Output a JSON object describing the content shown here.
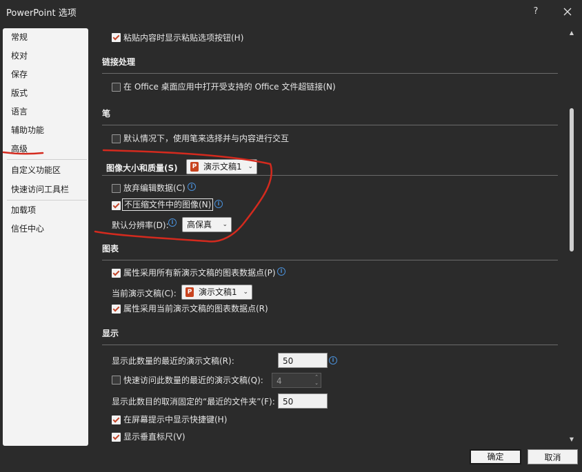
{
  "window": {
    "title": "PowerPoint 选项",
    "help_label": "?",
    "buttons": {
      "ok": "确定",
      "cancel": "取消"
    }
  },
  "sidebar": {
    "items": [
      {
        "label": "常规"
      },
      {
        "label": "校对"
      },
      {
        "label": "保存"
      },
      {
        "label": "版式"
      },
      {
        "label": "语言"
      },
      {
        "label": "辅助功能"
      },
      {
        "label": "高级",
        "selected": true
      },
      {
        "label": "自定义功能区"
      },
      {
        "label": "快速访问工具栏"
      },
      {
        "label": "加载项"
      },
      {
        "label": "信任中心"
      }
    ]
  },
  "content": {
    "paste_option": {
      "label": "粘贴内容时显示粘贴选项按钮(H)",
      "checked": true
    },
    "link_section": {
      "title": "链接处理",
      "open_links": {
        "label": "在 Office 桌面应用中打开受支持的 Office 文件超链接(N)",
        "checked": false
      }
    },
    "pen_section": {
      "title": "笔",
      "use_pen": {
        "label": "默认情况下，使用笔来选择并与内容进行交互",
        "checked": false
      }
    },
    "image_section": {
      "title": "图像大小和质量(S)",
      "document": "演示文稿1",
      "discard_edit": {
        "label": "放弃编辑数据(C)",
        "checked": false
      },
      "no_compress": {
        "label": "不压缩文件中的图像(N)",
        "checked": true
      },
      "resolution_label": "默认分辨率(D):",
      "resolution_value": "高保真"
    },
    "chart_section": {
      "title": "图表",
      "all_new": {
        "label": "属性采用所有新演示文稿的图表数据点(P)",
        "checked": true
      },
      "current_label": "当前演示文稿(C):",
      "current_doc": "演示文稿1",
      "current_props": {
        "label": "属性采用当前演示文稿的图表数据点(R)",
        "checked": true
      }
    },
    "display_section": {
      "title": "显示",
      "recent_count_label": "显示此数量的最近的演示文稿(R):",
      "recent_count_value": "50",
      "quick_access": {
        "label": "快速访问此数量的最近的演示文稿(Q):",
        "checked": false,
        "value": "4"
      },
      "unpinned_label": "显示此数目的取消固定的“最近的文件夹”(F):",
      "unpinned_value": "50",
      "shortcut_tips": {
        "label": "在屏幕提示中显示快捷键(H)",
        "checked": true
      },
      "vertical_ruler": {
        "label": "显示垂直标尺(V)",
        "checked": true
      }
    }
  },
  "icons": {
    "close": "close-icon",
    "info": "info-icon",
    "ppt": "powerpoint-icon",
    "chevron": "chevron-down-icon"
  },
  "colors": {
    "annotation": "#d42a1e",
    "checkbox_check": "#c3452a",
    "info_blue": "#4a90d9"
  }
}
